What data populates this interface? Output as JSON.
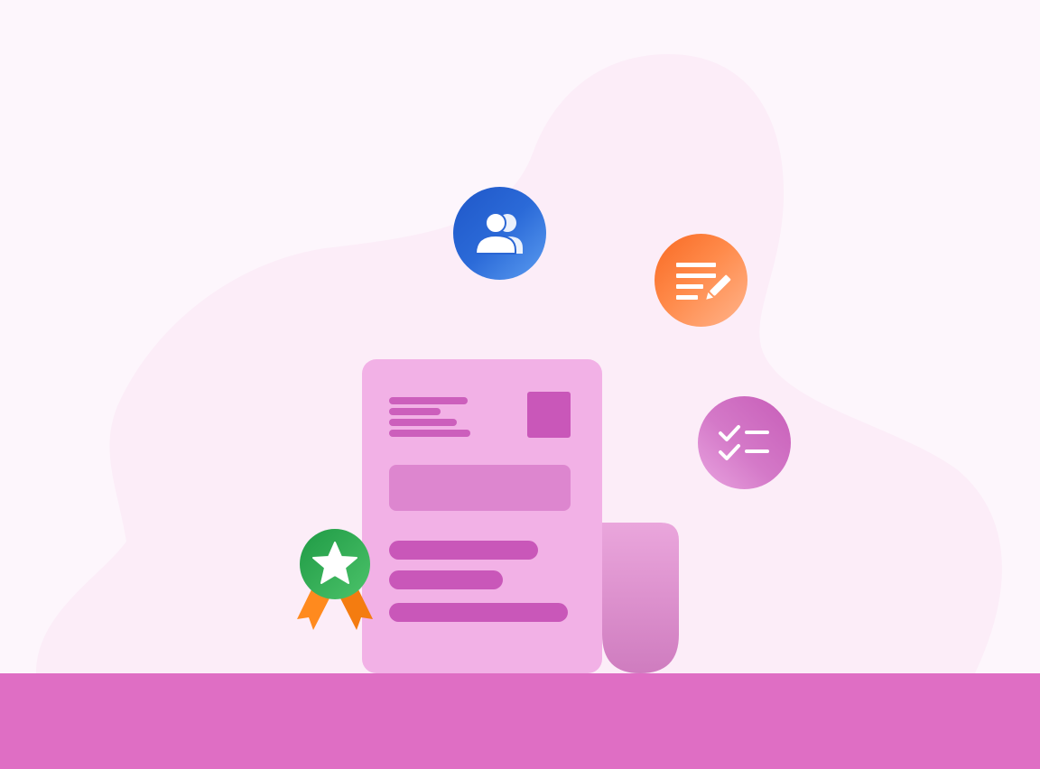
{
  "colors": {
    "background": "#fdf6fc",
    "blob": "#fcedf8",
    "floor": "#df6ec4",
    "document_sheet": "#f2b1e6",
    "document_accent": "#c957b9",
    "document_block": "#dd86cf",
    "team_bubble": "#2563d3",
    "edit_bubble": "#fb7c38",
    "checklist_bubble": "#d06fc2",
    "badge_medal": "#22a84e",
    "badge_ribbon": "#ff8a1e"
  },
  "icons": {
    "team": "users-icon",
    "edit": "notes-pencil-icon",
    "checklist": "checklist-icon",
    "badge": "star-medal-icon"
  }
}
